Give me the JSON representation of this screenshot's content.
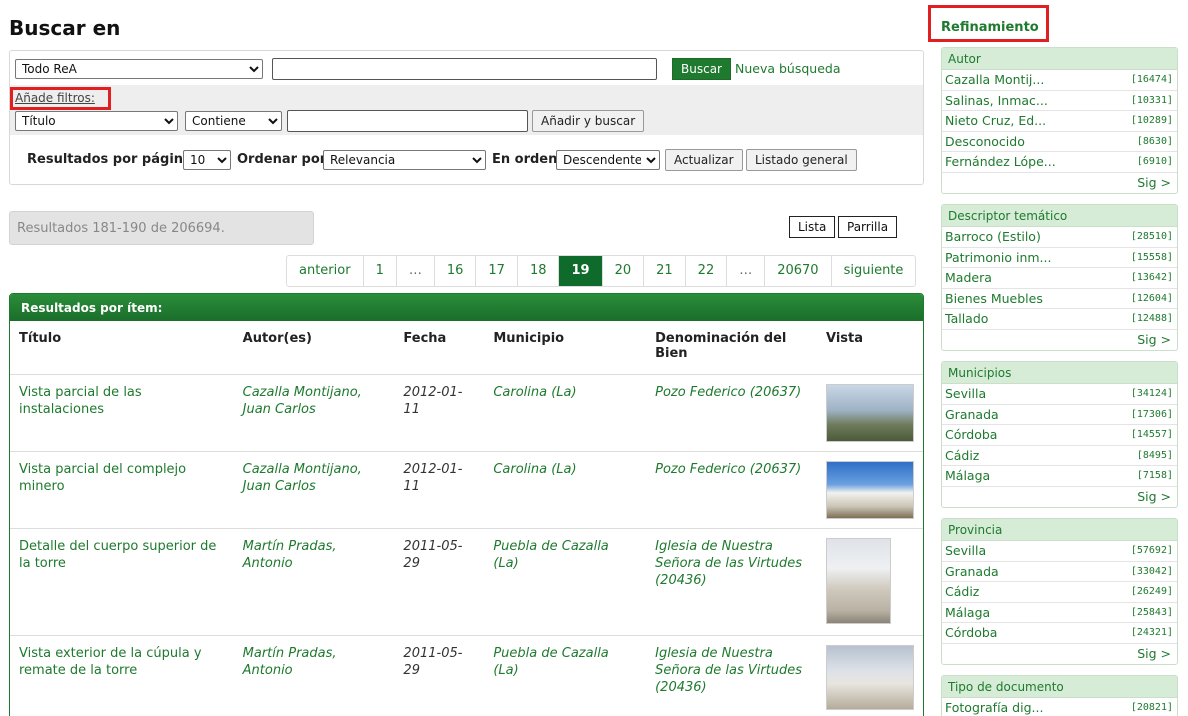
{
  "page_title": "Buscar en",
  "search": {
    "scope_value": "Todo ReA",
    "query_value": "",
    "search_button": "Buscar",
    "new_search": "Nueva búsqueda",
    "filters_label": "Añade filtros:",
    "filter_field": "Título",
    "filter_op": "Contiene",
    "filter_value": "",
    "add_search_button": "Añadir y buscar",
    "per_page_label": "Resultados por página",
    "per_page_value": "10",
    "order_by_label": "Ordenar por",
    "order_by_value": "Relevancia",
    "order_label": "En orden",
    "order_value": "Descendente",
    "update_button": "Actualizar",
    "list_button": "Listado general"
  },
  "results_count": "Resultados 181-190 de 206694.",
  "views": {
    "list": "Lista",
    "grid": "Parrilla"
  },
  "pager": [
    "anterior",
    "1",
    "…",
    "16",
    "17",
    "18",
    "19",
    "20",
    "21",
    "22",
    "…",
    "20670",
    "siguiente"
  ],
  "pager_active": "19",
  "results": {
    "header": "Resultados por ítem:",
    "columns": [
      "Título",
      "Autor(es)",
      "Fecha",
      "Municipio",
      "Denominación del Bien",
      "Vista"
    ],
    "rows": [
      {
        "title": "Vista parcial de las instalaciones",
        "author": "Cazalla Montijano, Juan Carlos",
        "date": "2012-01-11",
        "municipality": "Carolina (La)",
        "denomination": "Pozo Federico (20637)"
      },
      {
        "title": "Vista parcial del complejo minero",
        "author": "Cazalla Montijano, Juan Carlos",
        "date": "2012-01-11",
        "municipality": "Carolina (La)",
        "denomination": "Pozo Federico (20637)"
      },
      {
        "title": "Detalle del cuerpo superior de la torre",
        "author": "Martín Pradas, Antonio",
        "date": "2011-05-29",
        "municipality": "Puebla de Cazalla (La)",
        "denomination": "Iglesia de Nuestra Señora de las Virtudes (20436)"
      },
      {
        "title": "Vista exterior de la cúpula y remate de la torre",
        "author": "Martín Pradas, Antonio",
        "date": "2011-05-29",
        "municipality": "Puebla de Cazalla (La)",
        "denomination": "Iglesia de Nuestra Señora de las Virtudes (20436)"
      }
    ]
  },
  "refinement": {
    "title": "Refinamiento",
    "more": "Sig >",
    "facets": [
      {
        "name": "Autor",
        "items": [
          {
            "label": "Cazalla Montij...",
            "count": "[16474]"
          },
          {
            "label": "Salinas, Inmac...",
            "count": "[10331]"
          },
          {
            "label": "Nieto Cruz, Ed...",
            "count": "[10289]"
          },
          {
            "label": "Desconocido",
            "count": "[8630]"
          },
          {
            "label": "Fernández Lópe...",
            "count": "[6910]"
          }
        ]
      },
      {
        "name": "Descriptor temático",
        "items": [
          {
            "label": "Barroco (Estilo)",
            "count": "[28510]"
          },
          {
            "label": "Patrimonio inm...",
            "count": "[15558]"
          },
          {
            "label": "Madera",
            "count": "[13642]"
          },
          {
            "label": "Bienes Muebles",
            "count": "[12604]"
          },
          {
            "label": "Tallado",
            "count": "[12488]"
          }
        ]
      },
      {
        "name": "Municipios",
        "items": [
          {
            "label": "Sevilla",
            "count": "[34124]"
          },
          {
            "label": "Granada",
            "count": "[17306]"
          },
          {
            "label": "Córdoba",
            "count": "[14557]"
          },
          {
            "label": "Cádiz",
            "count": "[8495]"
          },
          {
            "label": "Málaga",
            "count": "[7158]"
          }
        ]
      },
      {
        "name": "Provincia",
        "items": [
          {
            "label": "Sevilla",
            "count": "[57692]"
          },
          {
            "label": "Granada",
            "count": "[33042]"
          },
          {
            "label": "Cádiz",
            "count": "[26249]"
          },
          {
            "label": "Málaga",
            "count": "[25843]"
          },
          {
            "label": "Córdoba",
            "count": "[24321]"
          }
        ]
      },
      {
        "name": "Tipo de documento",
        "items": [
          {
            "label": "Fotografía dig...",
            "count": "[20821]"
          }
        ]
      }
    ]
  }
}
